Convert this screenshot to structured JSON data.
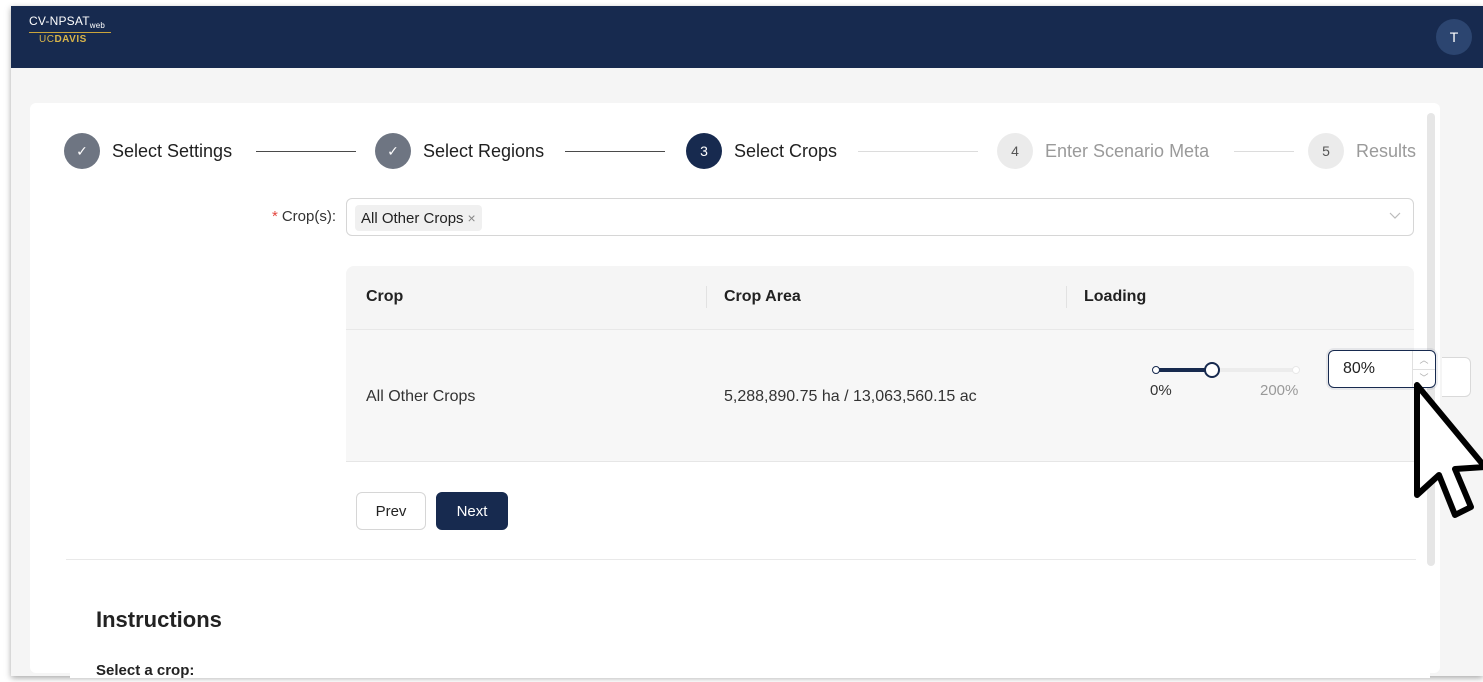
{
  "header": {
    "logo_main": "CV-NPSAT",
    "logo_sub": "web",
    "logo_org_prefix": "UC",
    "logo_org": "DAVIS",
    "avatar_initial": "T"
  },
  "steps": [
    {
      "index": "1",
      "label": "Select Settings",
      "status": "done"
    },
    {
      "index": "2",
      "label": "Select Regions",
      "status": "done"
    },
    {
      "index": "3",
      "label": "Select Crops",
      "status": "active"
    },
    {
      "index": "4",
      "label": "Enter Scenario Meta",
      "status": "wait"
    },
    {
      "index": "5",
      "label": "Results",
      "status": "wait"
    }
  ],
  "form": {
    "required_mark": "*",
    "crop_label": "Crop(s):",
    "selected_tag": "All Other Crops",
    "tag_remove": "×"
  },
  "table": {
    "columns": [
      "Crop",
      "Crop Area",
      "Loading"
    ],
    "rows": [
      {
        "crop": "All Other Crops",
        "area": "5,288,890.75 ha / 13,063,560.15 ac",
        "loading_value": 80,
        "loading_display": "80%",
        "slider_min_label": "0%",
        "slider_max_label": "200%"
      }
    ]
  },
  "buttons": {
    "prev": "Prev",
    "next": "Next"
  },
  "instructions": {
    "title": "Instructions",
    "subtitle": "Select a crop:"
  },
  "colors": {
    "brand_navy": "#172a4f",
    "required_red": "#e4463f"
  }
}
